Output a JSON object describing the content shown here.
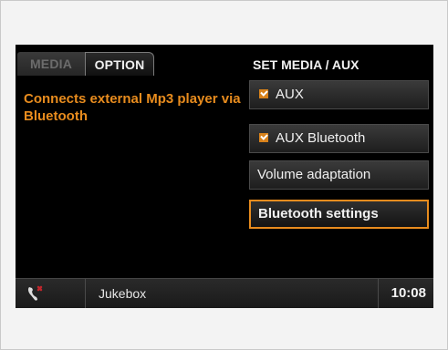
{
  "tabs": {
    "media_label": "MEDIA",
    "option_label": "OPTION"
  },
  "header": {
    "title": "SET MEDIA / AUX"
  },
  "description": "Connects external Mp3 player via Bluetooth",
  "menu": {
    "items": [
      {
        "label": "AUX",
        "checked": true
      },
      {
        "label": "AUX Bluetooth",
        "checked": true
      },
      {
        "label": "Volume adaptation",
        "checked": false
      },
      {
        "label": "Bluetooth settings",
        "checked": false,
        "selected": true
      }
    ]
  },
  "statusbar": {
    "phone_icon": "phone-hangup-icon",
    "source": "Jukebox",
    "time": "10:08"
  },
  "colors": {
    "accent": "#e88c1e",
    "check": "#d8821b"
  }
}
